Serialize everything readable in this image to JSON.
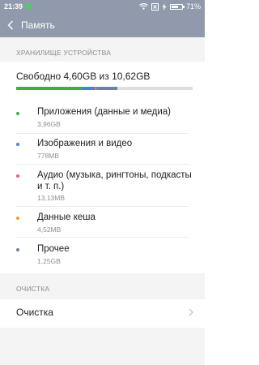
{
  "status_bar": {
    "time": "21:39",
    "battery_pct": "71%",
    "battery_level": 0.71
  },
  "header": {
    "title": "Память"
  },
  "storage": {
    "section_title": "ХРАНИЛИЩЕ УСТРОЙСТВА",
    "free_text": "Свободно 4,60GB из 10,62GB",
    "categories": [
      {
        "name": "Приложения (данные и медиа)",
        "size": "3,96GB",
        "color": "#3fae3f",
        "share": 0.3729
      },
      {
        "name": "Изображения и видео",
        "size": "778MB",
        "color": "#4a7fd9",
        "share": 0.0716
      },
      {
        "name": "Аудио (музыка, рингтоны, подкасты и т. п.)",
        "size": "13,13MB",
        "color": "#e8558a",
        "share": 0.0012
      },
      {
        "name": "Данные кеша",
        "size": "4,52MB",
        "color": "#f29b22",
        "share": 0.0004
      },
      {
        "name": "Прочее",
        "size": "1,25GB",
        "color": "#6f7fa0",
        "share": 0.1177
      }
    ]
  },
  "cleanup": {
    "section_title": "ОЧИСТКА",
    "item_label": "Очистка"
  },
  "icons": {
    "back": "chevron-left-icon",
    "wifi": "wifi-icon",
    "sim": "sim-icon",
    "charge": "charging-icon",
    "more": "chevron-right-icon"
  }
}
